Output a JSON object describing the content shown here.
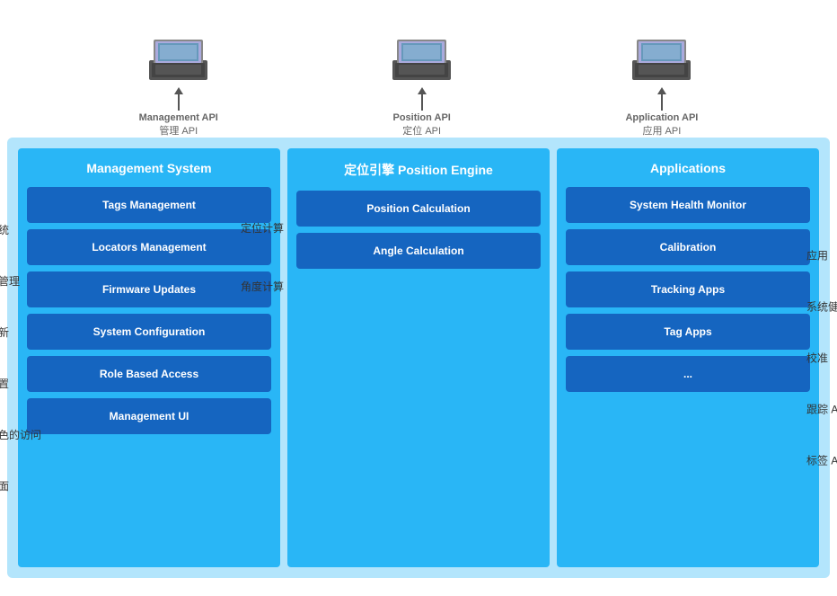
{
  "servers": [
    {
      "id": "management",
      "api_label_en": "Management API",
      "api_label_cn": "管理 API"
    },
    {
      "id": "position",
      "api_label_en": "Position API",
      "api_label_cn": "定位 API"
    },
    {
      "id": "application",
      "api_label_en": "Application API",
      "api_label_cn": "应用 API"
    }
  ],
  "management_system": {
    "title_en": "Management System",
    "title_cn": "管理系统",
    "buttons": [
      {
        "id": "tags-mgmt",
        "label": "Tags Management",
        "label_cn": ""
      },
      {
        "id": "locators-mgmt",
        "label": "Locators Management",
        "label_cn": "定位器管理"
      },
      {
        "id": "firmware-updates",
        "label": "Firmware Updates",
        "label_cn": "固件更新"
      },
      {
        "id": "system-config",
        "label": "System Configuration",
        "label_cn": "系统配置"
      },
      {
        "id": "role-based",
        "label": "Role Based Access",
        "label_cn": "基于角色的访问"
      },
      {
        "id": "mgmt-ui",
        "label": "Management UI",
        "label_cn": "管理界面"
      }
    ]
  },
  "position_engine": {
    "title_en": "Position Engine",
    "title_cn": "定位引擎",
    "buttons": [
      {
        "id": "pos-calc",
        "label": "Position Calculation",
        "label_cn": "定位计算"
      },
      {
        "id": "angle-calc",
        "label": "Angle Calculation",
        "label_cn": "角度计算"
      }
    ]
  },
  "applications": {
    "title_en": "Applications",
    "title_cn": "应用",
    "buttons": [
      {
        "id": "sys-health",
        "label": "System Health Monitor",
        "label_cn": "系统健康监控"
      },
      {
        "id": "calibration",
        "label": "Calibration",
        "label_cn": "校准"
      },
      {
        "id": "tracking-apps",
        "label": "Tracking Apps",
        "label_cn": "跟踪 App"
      },
      {
        "id": "tag-apps",
        "label": "Tag Apps",
        "label_cn": "标签 App"
      },
      {
        "id": "more",
        "label": "...",
        "label_cn": ""
      }
    ]
  }
}
